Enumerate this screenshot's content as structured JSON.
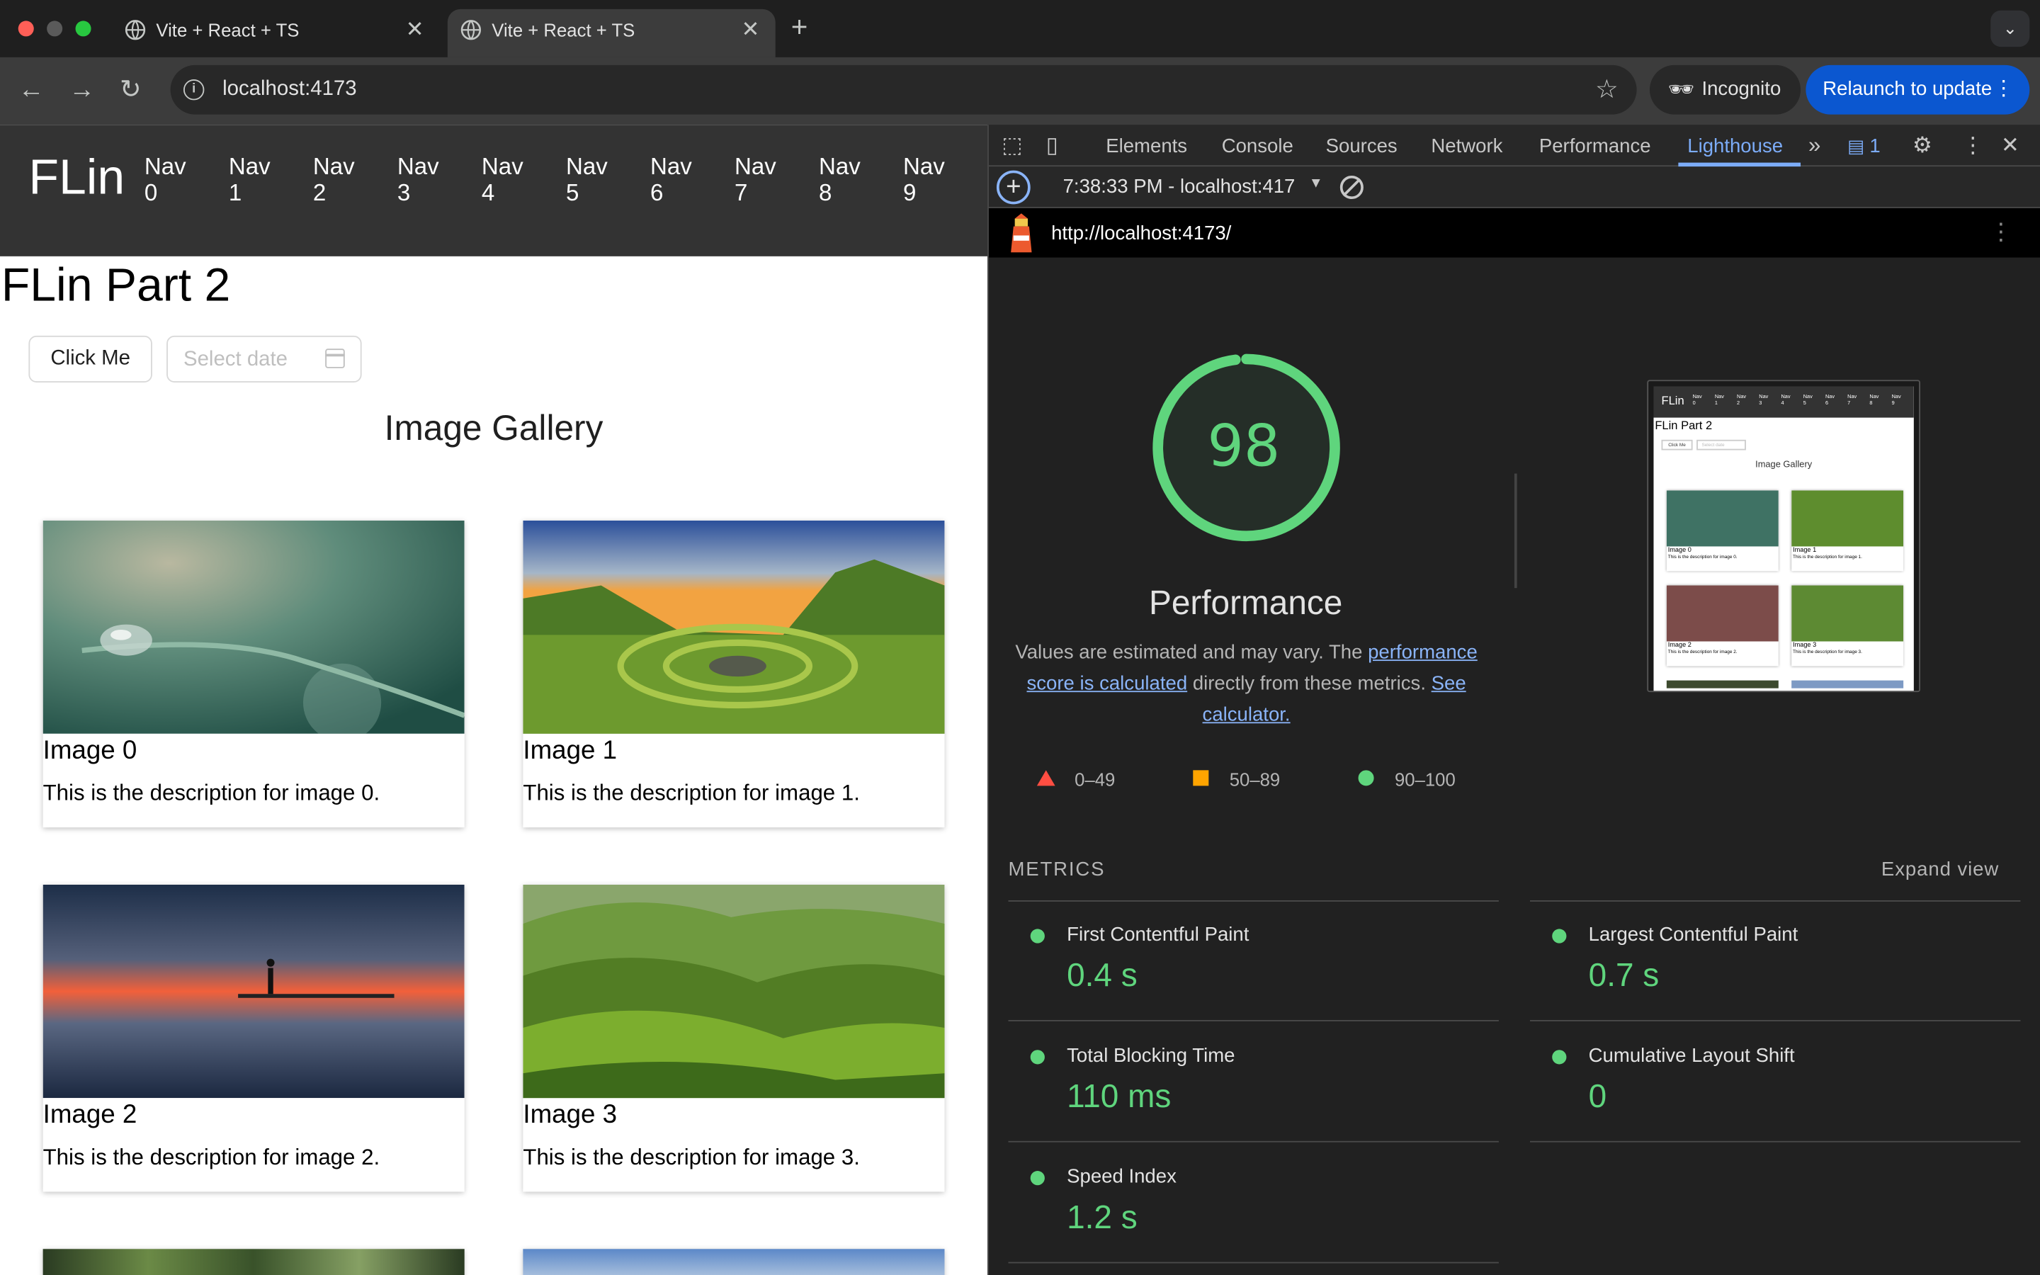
{
  "browser": {
    "tabs": [
      {
        "title": "Vite + React + TS",
        "active": false
      },
      {
        "title": "Vite + React + TS",
        "active": true
      }
    ],
    "new_tab_symbol": "+",
    "tab_search_symbol": "⌄",
    "url": "localhost:4173",
    "incognito_label": "Incognito",
    "relaunch_label": "Relaunch to update"
  },
  "page": {
    "brand": "FLin",
    "nav_items": [
      {
        "line1": "Nav",
        "line2": "0"
      },
      {
        "line1": "Nav",
        "line2": "1"
      },
      {
        "line1": "Nav",
        "line2": "2"
      },
      {
        "line1": "Nav",
        "line2": "3"
      },
      {
        "line1": "Nav",
        "line2": "4"
      },
      {
        "line1": "Nav",
        "line2": "5"
      },
      {
        "line1": "Nav",
        "line2": "6"
      },
      {
        "line1": "Nav",
        "line2": "7"
      },
      {
        "line1": "Nav",
        "line2": "8"
      },
      {
        "line1": "Nav",
        "line2": "9"
      }
    ],
    "heading": "FLin Part 2",
    "click_button": "Click Me",
    "date_placeholder": "Select date",
    "gallery_title": "Image Gallery",
    "cards": [
      {
        "title": "Image 0",
        "description": "This is the description for image 0."
      },
      {
        "title": "Image 1",
        "description": "This is the description for image 1."
      },
      {
        "title": "Image 2",
        "description": "This is the description for image 2."
      },
      {
        "title": "Image 3",
        "description": "This is the description for image 3."
      }
    ]
  },
  "devtools": {
    "tabs": [
      "Elements",
      "Console",
      "Sources",
      "Network",
      "Performance",
      "Lighthouse"
    ],
    "active_tab": "Lighthouse",
    "issues_count": "1",
    "report_selector": "7:38:33 PM - localhost:417",
    "lighthouse_url": "http://localhost:4173/",
    "score": "98",
    "category": "Performance",
    "desc_part1": "Values are estimated and may vary. The ",
    "desc_link1": "performance score is calculated",
    "desc_part2": " directly from these metrics. ",
    "desc_link2": "See calculator.",
    "legend": [
      {
        "label": "0–49",
        "color": "#ff4e42"
      },
      {
        "label": "50–89",
        "color": "#ffa400"
      },
      {
        "label": "90–100",
        "color": "#5fd57d"
      }
    ],
    "metrics_heading": "METRICS",
    "expand_label": "Expand view",
    "metrics": [
      {
        "name": "First Contentful Paint",
        "value": "0.4 s"
      },
      {
        "name": "Largest Contentful Paint",
        "value": "0.7 s"
      },
      {
        "name": "Total Blocking Time",
        "value": "110 ms"
      },
      {
        "name": "Cumulative Layout Shift",
        "value": "0"
      },
      {
        "name": "Speed Index",
        "value": "1.2 s"
      }
    ],
    "thumbnail": {
      "brand": "FLin",
      "nav_label": "Nav",
      "heading": "FLin Part 2",
      "button": "Click Me",
      "date": "Select date",
      "gallery_title": "Image Gallery",
      "cards": [
        {
          "title": "Image 0",
          "description": "This is the description for image 0."
        },
        {
          "title": "Image 1",
          "description": "This is the description for image 1."
        },
        {
          "title": "Image 2",
          "description": "This is the description for image 2."
        },
        {
          "title": "Image 3",
          "description": "This is the description for image 3."
        }
      ]
    }
  },
  "colors": {
    "score_green": "#5fd57d",
    "link_blue": "#8ab4f8",
    "relaunch_blue": "#0b57d0",
    "active_tab_blue": "#7cacf8"
  }
}
